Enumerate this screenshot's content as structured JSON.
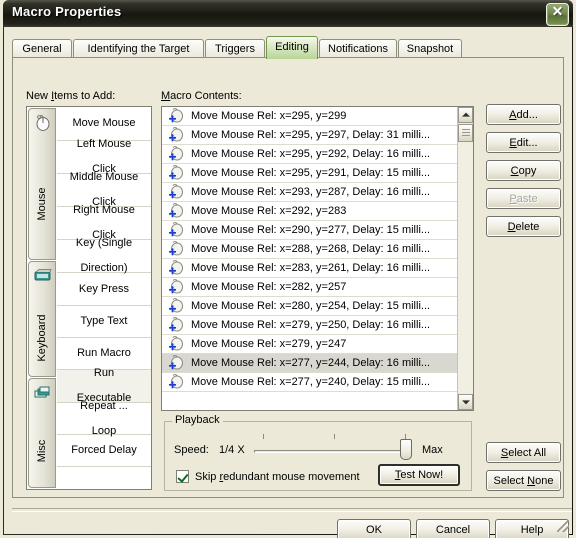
{
  "window": {
    "title": "Macro Properties",
    "close_label": "Close"
  },
  "tabs": [
    {
      "label": "General",
      "active": false
    },
    {
      "label": "Identifying the Target",
      "active": false
    },
    {
      "label": "Triggers",
      "active": false
    },
    {
      "label": "Editing",
      "active": true
    },
    {
      "label": "Notifications",
      "active": false
    },
    {
      "label": "Snapshot",
      "active": false
    }
  ],
  "left_panel": {
    "label_prefix": "New ",
    "label_accel": "I",
    "label_suffix": "tems to Add:",
    "categories": [
      {
        "name": "Mouse",
        "icon": "mouse-icon"
      },
      {
        "name": "Keyboard",
        "icon": "keyboard-icon"
      },
      {
        "name": "Misc",
        "icon": "windows-stack-icon"
      }
    ],
    "items": [
      {
        "line1": "Move Mouse",
        "line2": ""
      },
      {
        "line1": "Left Mouse",
        "line2": "Click"
      },
      {
        "line1": "Middle Mouse",
        "line2": "Click"
      },
      {
        "line1": "Right Mouse",
        "line2": "Click"
      },
      {
        "line1": "Key (Single",
        "line2": "Direction)"
      },
      {
        "line1": "Key Press",
        "line2": ""
      },
      {
        "line1": "Type Text",
        "line2": ""
      },
      {
        "line1": "Run Macro",
        "line2": ""
      },
      {
        "line1": "Run",
        "line2": "Executable"
      },
      {
        "line1": "Repeat ...",
        "line2": "Loop"
      },
      {
        "line1": "Forced Delay",
        "line2": ""
      }
    ]
  },
  "contents": {
    "label_accel": "M",
    "label_rest": "acro Contents:",
    "rows": [
      {
        "text": "Move Mouse Rel: x=295, y=299",
        "selected": false
      },
      {
        "text": "Move Mouse Rel: x=295, y=297, Delay: 31 milli...",
        "selected": false
      },
      {
        "text": "Move Mouse Rel: x=295, y=292, Delay: 16 milli...",
        "selected": false
      },
      {
        "text": "Move Mouse Rel: x=295, y=291, Delay: 15 milli...",
        "selected": false
      },
      {
        "text": "Move Mouse Rel: x=293, y=287, Delay: 16 milli...",
        "selected": false
      },
      {
        "text": "Move Mouse Rel: x=292, y=283",
        "selected": false
      },
      {
        "text": "Move Mouse Rel: x=290, y=277, Delay: 15 milli...",
        "selected": false
      },
      {
        "text": "Move Mouse Rel: x=288, y=268, Delay: 16 milli...",
        "selected": false
      },
      {
        "text": "Move Mouse Rel: x=283, y=261, Delay: 16 milli...",
        "selected": false
      },
      {
        "text": "Move Mouse Rel: x=282, y=257",
        "selected": false
      },
      {
        "text": "Move Mouse Rel: x=280, y=254, Delay: 15 milli...",
        "selected": false
      },
      {
        "text": "Move Mouse Rel: x=279, y=250, Delay: 16 milli...",
        "selected": false
      },
      {
        "text": "Move Mouse Rel: x=279, y=247",
        "selected": false
      },
      {
        "text": "Move Mouse Rel: x=277, y=244, Delay: 16 milli...",
        "selected": true
      },
      {
        "text": "Move Mouse Rel: x=277, y=240, Delay: 15 milli...",
        "selected": false
      }
    ]
  },
  "playback": {
    "title": "Playback",
    "speed_label": "Speed:",
    "speed_value": "1/4 X",
    "max_label": "Max",
    "checkbox": {
      "checked": true,
      "prefix": "Skip ",
      "accel": "r",
      "suffix": "edundant mouse movement"
    },
    "test_button": {
      "accel": "T",
      "rest": "est Now!"
    }
  },
  "side_buttons": [
    {
      "accel": "A",
      "rest": "dd...",
      "disabled": false
    },
    {
      "accel": "E",
      "rest": "dit...",
      "disabled": false
    },
    {
      "accel": "C",
      "rest": "opy",
      "disabled": false
    },
    {
      "accel": "P",
      "rest": "aste",
      "disabled": true
    },
    {
      "accel": "D",
      "rest": "elete",
      "disabled": false
    }
  ],
  "select_buttons": [
    {
      "accel": "S",
      "rest": "elect All",
      "prefix": "",
      "disabled": false
    },
    {
      "accel": "N",
      "rest": "one",
      "prefix": "Select ",
      "disabled": false
    }
  ],
  "footer_buttons": [
    {
      "label": "OK",
      "default": true
    },
    {
      "label": "Cancel",
      "default": false
    },
    {
      "label": "Help",
      "default": false
    }
  ]
}
